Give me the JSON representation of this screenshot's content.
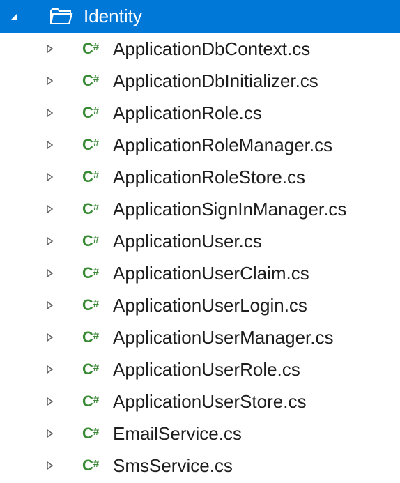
{
  "folder": {
    "name": "Identity",
    "icon": "folder-open-icon"
  },
  "files": [
    {
      "name": "ApplicationDbContext.cs",
      "icon": "csharp-icon"
    },
    {
      "name": "ApplicationDbInitializer.cs",
      "icon": "csharp-icon"
    },
    {
      "name": "ApplicationRole.cs",
      "icon": "csharp-icon"
    },
    {
      "name": "ApplicationRoleManager.cs",
      "icon": "csharp-icon"
    },
    {
      "name": "ApplicationRoleStore.cs",
      "icon": "csharp-icon"
    },
    {
      "name": "ApplicationSignInManager.cs",
      "icon": "csharp-icon"
    },
    {
      "name": "ApplicationUser.cs",
      "icon": "csharp-icon"
    },
    {
      "name": "ApplicationUserClaim.cs",
      "icon": "csharp-icon"
    },
    {
      "name": "ApplicationUserLogin.cs",
      "icon": "csharp-icon"
    },
    {
      "name": "ApplicationUserManager.cs",
      "icon": "csharp-icon"
    },
    {
      "name": "ApplicationUserRole.cs",
      "icon": "csharp-icon"
    },
    {
      "name": "ApplicationUserStore.cs",
      "icon": "csharp-icon"
    },
    {
      "name": "EmailService.cs",
      "icon": "csharp-icon"
    },
    {
      "name": "SmsService.cs",
      "icon": "csharp-icon"
    }
  ]
}
